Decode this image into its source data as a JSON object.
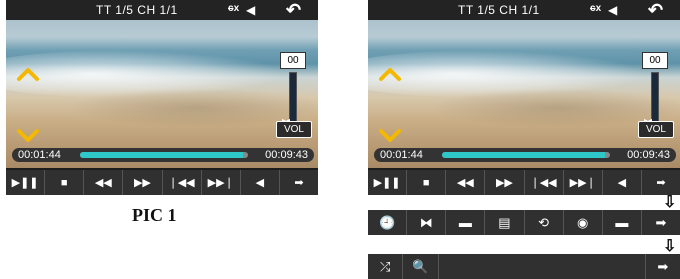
{
  "screens": [
    {
      "osd": "TT  1/5  CH  1/1",
      "subtitle_icon": "subtitle-off-icon",
      "volume_value": "00",
      "volume_label": "VOL",
      "time_start": "00:01:44",
      "time_end": "00:09:43",
      "progress_fraction": 0.97
    },
    {
      "osd": "TT  1/5  CH  1/1",
      "subtitle_icon": "subtitle-off-icon",
      "volume_value": "00",
      "volume_label": "VOL",
      "time_start": "00:01:44",
      "time_end": "00:09:43",
      "progress_fraction": 0.97
    }
  ],
  "control_buttons": [
    {
      "icon": "play-pause-icon",
      "glyph": "▶❚❚"
    },
    {
      "icon": "stop-icon",
      "glyph": "■"
    },
    {
      "icon": "rewind-icon",
      "glyph": "◀◀"
    },
    {
      "icon": "fast-forward-icon",
      "glyph": "▶▶"
    },
    {
      "icon": "previous-icon",
      "glyph": "❘◀◀"
    },
    {
      "icon": "next-icon",
      "glyph": "▶▶❘"
    },
    {
      "icon": "mute-icon",
      "glyph": "◀"
    },
    {
      "icon": "more-arrow-icon",
      "glyph": "➡"
    }
  ],
  "menu_row_1": [
    {
      "icon": "clock-icon",
      "glyph": "🕘"
    },
    {
      "icon": "bowtie-icon",
      "glyph": "⧓"
    },
    {
      "icon": "folder-icon",
      "glyph": "▬"
    },
    {
      "icon": "title-doc-icon",
      "glyph": "▤"
    },
    {
      "icon": "repeat-icon",
      "glyph": "⟲"
    },
    {
      "icon": "eye-icon",
      "glyph": "◉"
    },
    {
      "icon": "screen-icon",
      "glyph": "▬"
    },
    {
      "icon": "more-arrow-icon",
      "glyph": "➡"
    }
  ],
  "menu_row_2": [
    {
      "icon": "shuffle-icon",
      "glyph": "⤮"
    },
    {
      "icon": "search-icon",
      "glyph": "🔍"
    },
    {
      "icon": "more-arrow-icon",
      "glyph": "➡"
    }
  ],
  "label": "PIC 1",
  "down_arrow_glyph": "⇩",
  "accent_color": "#2ec8c8",
  "chevron_color": "#f5b800"
}
